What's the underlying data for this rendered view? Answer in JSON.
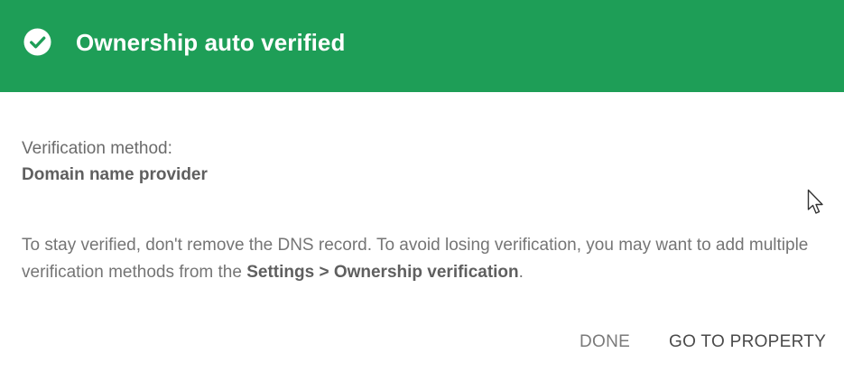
{
  "header": {
    "title": "Ownership auto verified",
    "icon": "check-circle-icon",
    "color": "#1e9e57"
  },
  "verification": {
    "label": "Verification method:",
    "value": "Domain name provider"
  },
  "info": {
    "text_before": "To stay verified, don't remove the DNS record. To avoid losing verification, you may want to add multiple verification methods from the ",
    "link_text": "Settings > Ownership verification",
    "text_after": "."
  },
  "actions": {
    "done_label": "DONE",
    "go_label": "GO TO PROPERTY"
  }
}
